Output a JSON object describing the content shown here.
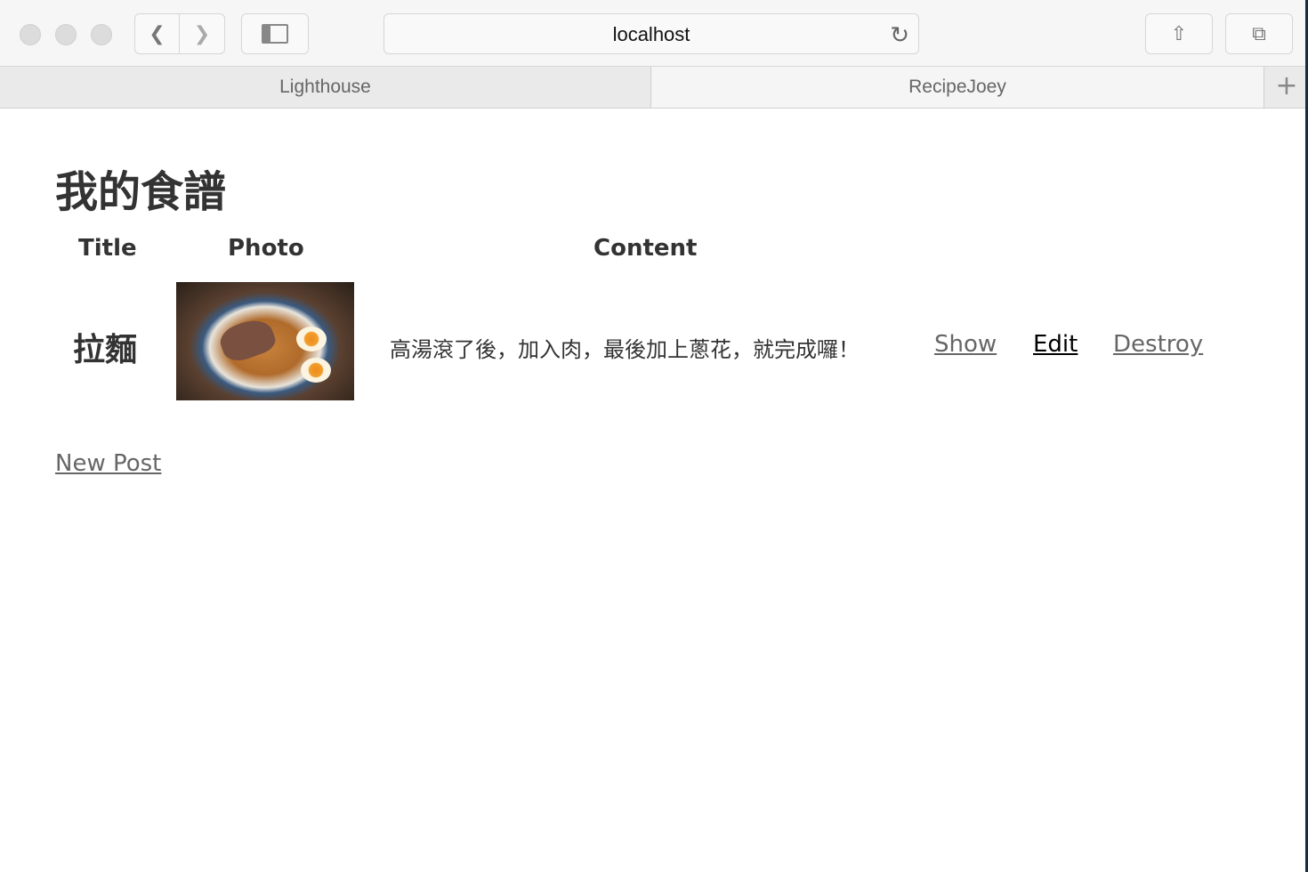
{
  "browser": {
    "url": "localhost",
    "tabs": [
      {
        "label": "Lighthouse"
      },
      {
        "label": "RecipeJoey"
      }
    ]
  },
  "page": {
    "heading": "我的食譜",
    "columns": [
      "Title",
      "Photo",
      "Content"
    ],
    "rows": [
      {
        "title": "拉麵",
        "photo_alt": "ramen bowl photo",
        "content": "高湯滾了後，加入肉，最後加上蔥花，就完成囉！",
        "show": "Show",
        "edit": "Edit",
        "destroy": "Destroy"
      }
    ],
    "new_post": "New Post"
  }
}
